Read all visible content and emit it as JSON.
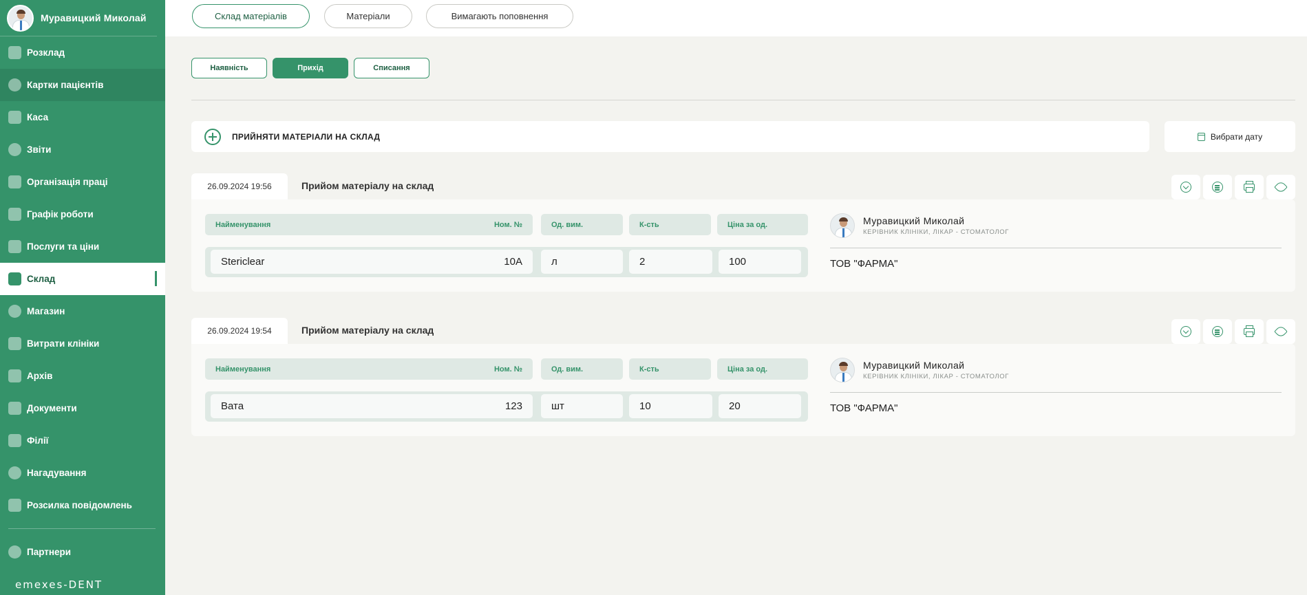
{
  "user": {
    "name": "Муравицкий Миколай"
  },
  "nav": [
    {
      "label": "Розклад",
      "icon": "calendar-list-icon",
      "state": ""
    },
    {
      "label": "Картки пацієнтів",
      "icon": "users-icon",
      "state": "dim"
    },
    {
      "label": "Каса",
      "icon": "wallet-icon",
      "state": ""
    },
    {
      "label": "Звіти",
      "icon": "dots-icon",
      "state": ""
    },
    {
      "label": "Організація праці",
      "icon": "briefcase-icon",
      "state": ""
    },
    {
      "label": "Графік роботи",
      "icon": "calendar-icon",
      "state": ""
    },
    {
      "label": "Послуги та ціни",
      "icon": "chart-icon",
      "state": ""
    },
    {
      "label": "Склад",
      "icon": "cart-icon",
      "state": "active"
    },
    {
      "label": "Магазин",
      "icon": "bag-icon",
      "state": ""
    },
    {
      "label": "Витрати клініки",
      "icon": "bars-icon",
      "state": ""
    },
    {
      "label": "Архів",
      "icon": "archive-icon",
      "state": ""
    },
    {
      "label": "Документи",
      "icon": "document-icon",
      "state": ""
    },
    {
      "label": "Філії",
      "icon": "home-icon",
      "state": ""
    },
    {
      "label": "Нагадування",
      "icon": "bell-icon",
      "state": ""
    },
    {
      "label": "Розсилка повідомлень",
      "icon": "mail-icon",
      "state": ""
    }
  ],
  "nav_bottom": {
    "label": "Партнери",
    "icon": "star-icon"
  },
  "brand": "emexes-DENT",
  "top_tabs": [
    "Склад матеріалів",
    "Матеріали",
    "Вимагають поповнення"
  ],
  "sub_tabs": [
    "Наявність",
    "Прихід",
    "Списання"
  ],
  "accept_label": "ПРИЙНЯТИ МАТЕРІАЛИ НА СКЛАД",
  "date_button": "Вибрати дату",
  "columns": {
    "name": "Найменування",
    "number": "Ном. №",
    "unit": "Од. вим.",
    "qty": "К-сть",
    "price": "Ціна за од."
  },
  "entries": [
    {
      "datetime": "26.09.2024 19:56",
      "title": "Прийом матеріалу на склад",
      "item": {
        "name": "Stericlear",
        "number": "10A",
        "unit": "л",
        "qty": "2",
        "price": "100"
      },
      "person": {
        "name": "Муравицкий Миколай",
        "role": "КЕРІВНИК КЛІНІКИ, ЛІКАР - СТОМАТОЛОГ"
      },
      "company": "ТОВ \"ФАРМА\""
    },
    {
      "datetime": "26.09.2024 19:54",
      "title": "Прийом матеріалу на склад",
      "item": {
        "name": "Вата",
        "number": "123",
        "unit": "шт",
        "qty": "10",
        "price": "20"
      },
      "person": {
        "name": "Муравицкий Миколай",
        "role": "КЕРІВНИК КЛІНІКИ, ЛІКАР - СТОМАТОЛОГ"
      },
      "company": "ТОВ \"ФАРМА\""
    }
  ],
  "colors": {
    "accent": "#35936a",
    "background": "#f3f3ef"
  }
}
